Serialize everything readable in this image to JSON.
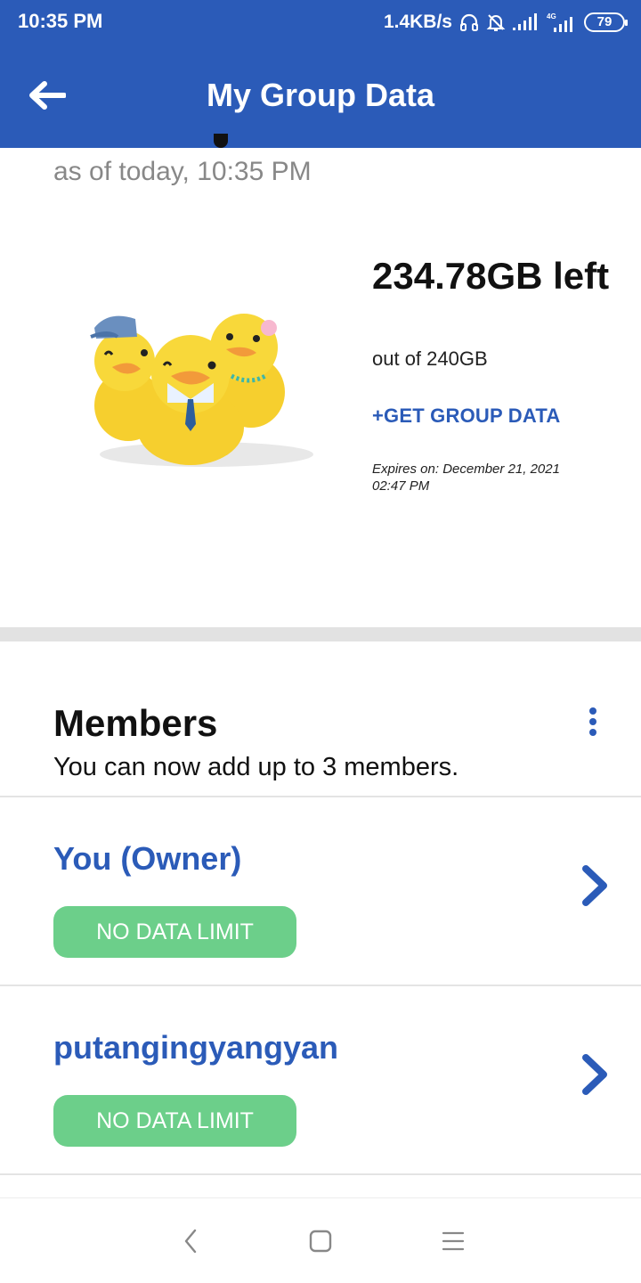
{
  "status_bar": {
    "time": "10:35 PM",
    "net_speed": "1.4KB/s",
    "battery": "79",
    "icons": [
      "headphones-icon",
      "bell-off-icon",
      "signal-icon",
      "signal-4g-icon",
      "battery-icon"
    ]
  },
  "app_bar": {
    "title": "My Group Data",
    "back_icon": "arrow-left-icon"
  },
  "summary": {
    "as_of": "as of today, 10:35 PM",
    "remaining": "234.78GB left",
    "total": "out of 240GB",
    "get_data_label": "+GET GROUP DATA",
    "expires": "Expires on: December 21, 2021 02:47 PM",
    "illustration": "ducks-illustration"
  },
  "members": {
    "title": "Members",
    "subtitle": "You can now add up to 3 members.",
    "menu_icon": "more-vertical-icon",
    "list": [
      {
        "name": "You (Owner)",
        "badge": "NO DATA LIMIT"
      },
      {
        "name": "putangingyangyan",
        "badge": "NO DATA LIMIT"
      }
    ]
  },
  "colors": {
    "primary": "#2b5bb8",
    "badge_green": "#6ccf8a",
    "divider": "#e2e2e2",
    "muted_text": "#888888"
  },
  "nav": {
    "icons": [
      "nav-back-icon",
      "nav-home-icon",
      "nav-recents-icon"
    ]
  }
}
